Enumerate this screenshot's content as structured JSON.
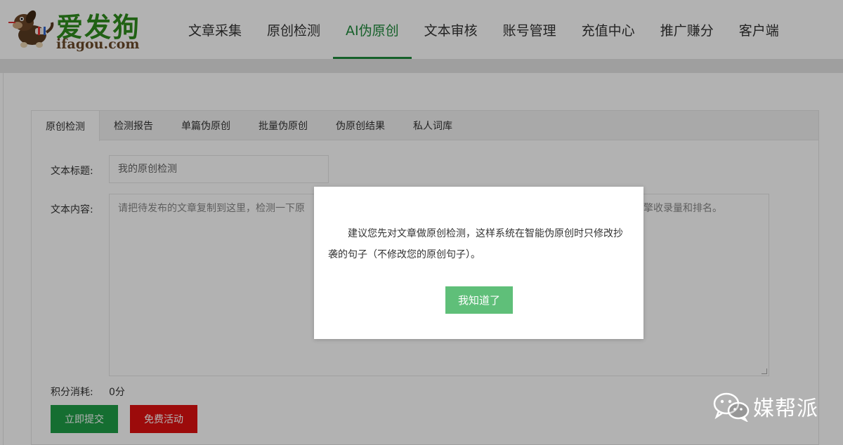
{
  "logo": {
    "title": "爱发狗",
    "domain": "ifagou.com"
  },
  "nav": {
    "items": [
      {
        "label": "文章采集"
      },
      {
        "label": "原创检测"
      },
      {
        "label": "AI伪原创"
      },
      {
        "label": "文本审核"
      },
      {
        "label": "账号管理"
      },
      {
        "label": "充值中心"
      },
      {
        "label": "推广赚分"
      },
      {
        "label": "客户端"
      }
    ],
    "active_index": 2,
    "active_color": "#1f8a3c"
  },
  "tabs": {
    "items": [
      {
        "label": "原创检测"
      },
      {
        "label": "检测报告"
      },
      {
        "label": "单篇伪原创"
      },
      {
        "label": "批量伪原创"
      },
      {
        "label": "伪原创结果"
      },
      {
        "label": "私人词库"
      }
    ],
    "active_index": 0
  },
  "form": {
    "title_label": "文本标题:",
    "title_placeholder": "我的原创检测",
    "content_label": "文本内容:",
    "content_placeholder_start": "请把待发布的文章复制到这里，检测一下原",
    "content_placeholder_end": "擎收录量和排名。",
    "score_label": "积分消耗:",
    "score_value": "0分",
    "submit_label": "立即提交",
    "free_label": "免费活动"
  },
  "modal": {
    "message": "建议您先对文章做原创检测，这样系统在智能伪原创时只修改抄袭的句子（不修改您的原创句子）。",
    "confirm_label": "我知道了"
  },
  "watermark": {
    "text": "媒帮派",
    "icon": "wechat-icon"
  },
  "colors": {
    "brand_green": "#1f8a3c",
    "submit_green": "#1f9e47",
    "free_red": "#e01010",
    "modal_button": "#5fbf79"
  }
}
